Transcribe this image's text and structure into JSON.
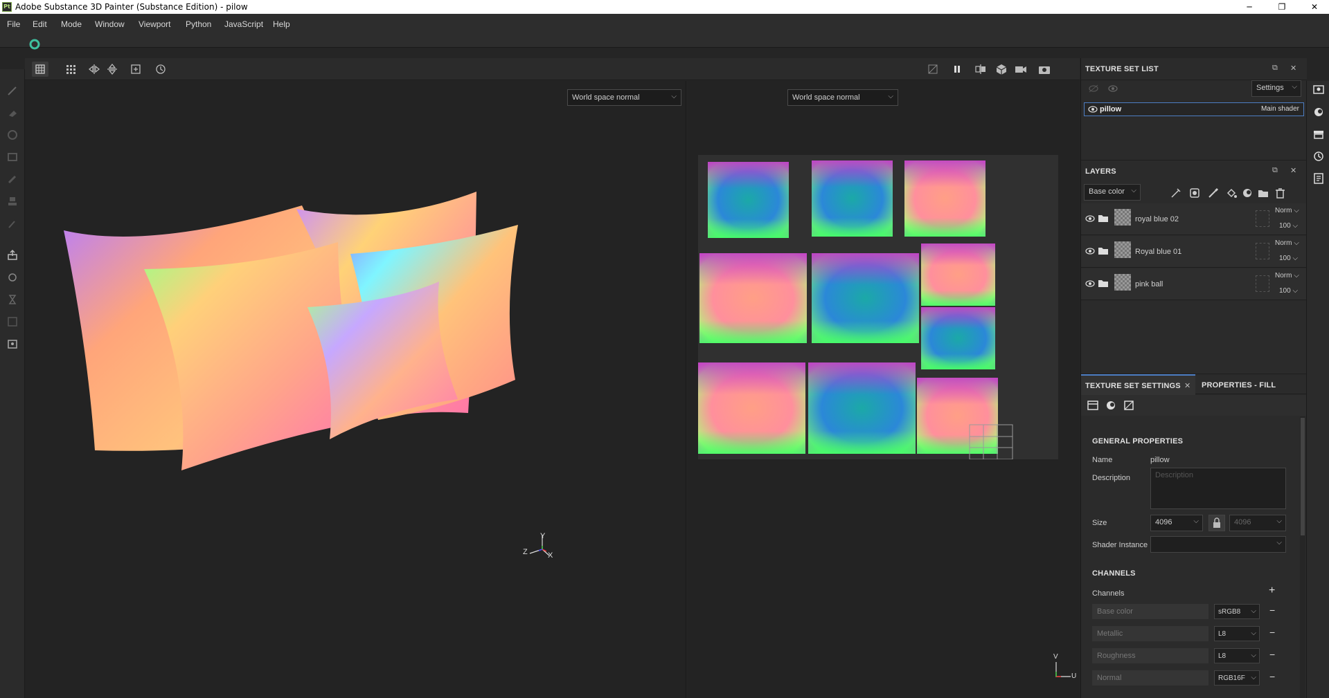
{
  "window": {
    "app_badge": "Pt",
    "title": "Adobe Substance 3D Painter (Substance Edition) - pilow",
    "minimize": "─",
    "maximize": "❐",
    "close": "✕"
  },
  "menu": [
    "File",
    "Edit",
    "Mode",
    "Window",
    "Viewport",
    "Python",
    "JavaScript",
    "Help"
  ],
  "viewport": {
    "left_mode": "World space normal",
    "right_mode": "World space normal",
    "axis_3d": {
      "y": "Y",
      "z": "Z",
      "x": "X"
    },
    "axis_2d": {
      "v": "V",
      "u": "U"
    }
  },
  "texture_set_list": {
    "title": "TEXTURE SET LIST",
    "settings_label": "Settings",
    "items": [
      {
        "name": "pillow",
        "shader": "Main shader"
      }
    ]
  },
  "layers": {
    "title": "LAYERS",
    "channel_select": "Base color",
    "items": [
      {
        "name": "royal blue 02",
        "blend": "Norm",
        "opacity": "100"
      },
      {
        "name": "Royal blue 01",
        "blend": "Norm",
        "opacity": "100"
      },
      {
        "name": "pink ball",
        "blend": "Norm",
        "opacity": "100"
      }
    ]
  },
  "tabs": {
    "texture_set_settings": "TEXTURE SET SETTINGS",
    "properties_fill": "PROPERTIES - FILL"
  },
  "general_properties": {
    "heading": "GENERAL PROPERTIES",
    "name_label": "Name",
    "name_value": "pillow",
    "description_label": "Description",
    "description_placeholder": "Description",
    "size_label": "Size",
    "size_value": "4096",
    "size_value_locked": "4096",
    "shader_instance_label": "Shader Instance",
    "shader_instance_value": ""
  },
  "channels": {
    "heading": "CHANNELS",
    "label": "Channels",
    "add": "+",
    "remove": "−",
    "items": [
      {
        "name": "Base color",
        "format": "sRGB8"
      },
      {
        "name": "Metallic",
        "format": "L8"
      },
      {
        "name": "Roughness",
        "format": "L8"
      },
      {
        "name": "Normal",
        "format": "RGB16F"
      }
    ]
  },
  "colors": {
    "accent_blue": "#4d7ec4",
    "panel_bg": "#2b2b2b",
    "viewport_bg": "#232323"
  }
}
